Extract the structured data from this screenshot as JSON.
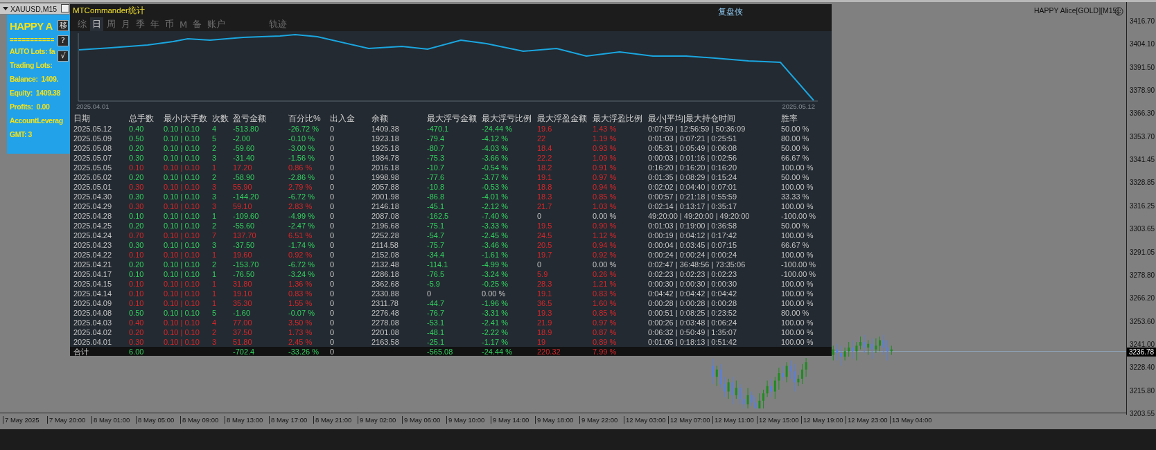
{
  "chart_window": {
    "symbol_tab": "XAUUSD,M15",
    "indicator_label": "HAPPY Alice[GOLD][M15]",
    "price_axis": [
      "3416.70",
      "3404.10",
      "3391.50",
      "3378.90",
      "3366.30",
      "3353.70",
      "3341.45",
      "3328.85",
      "3316.25",
      "3303.65",
      "3291.05",
      "3278.80",
      "3266.20",
      "3253.60",
      "3241.00",
      "3228.40",
      "3215.80",
      "3203.55"
    ],
    "current_price": "3236.78",
    "time_axis": [
      "7 May 2025",
      "7 May 20:00",
      "8 May 01:00",
      "8 May 05:00",
      "8 May 09:00",
      "8 May 13:00",
      "8 May 17:00",
      "8 May 21:00",
      "9 May 02:00",
      "9 May 06:00",
      "9 May 10:00",
      "9 May 14:00",
      "9 May 18:00",
      "9 May 22:00",
      "12 May 03:00",
      "12 May 07:00",
      "12 May 11:00",
      "12 May 15:00",
      "12 May 19:00",
      "12 May 23:00",
      "13 May 04:00"
    ]
  },
  "info_panel": {
    "title": "HAPPY A",
    "divider": "===========",
    "lines": [
      "AUTO Lots: fa",
      "Trading Lots:",
      "Balance:  1409.",
      "Equity:  1409.38",
      "Profits:  0.00",
      "AccountLeverag",
      "GMT: 3"
    ],
    "buttons": [
      "移",
      "?",
      "√"
    ]
  },
  "stats_window": {
    "title": "MTCommander统计",
    "brand": "复盘侠",
    "tabs": [
      {
        "label": "综",
        "selected": false
      },
      {
        "label": "日",
        "selected": true
      },
      {
        "label": "周",
        "selected": false
      },
      {
        "label": "月",
        "selected": false
      },
      {
        "label": "季",
        "selected": false
      },
      {
        "label": "年",
        "selected": false
      },
      {
        "label": "币",
        "selected": false
      },
      {
        "label": "M",
        "selected": false
      },
      {
        "label": "备",
        "selected": false
      },
      {
        "label": "账户",
        "selected": false
      }
    ],
    "trace_tab": "轨迹",
    "equity_chart": {
      "start_label": "2025.04.01",
      "end_label": "2025.05.12"
    },
    "table": {
      "columns": [
        "日期",
        "总手数",
        "最小|大手数",
        "次数",
        "盈亏金额",
        "百分比%",
        "出入金",
        "余额",
        "最大浮亏金额",
        "最大浮亏比例",
        "最大浮盈金额",
        "最大浮盈比例",
        "最小|平均|最大持仓时间",
        "胜率"
      ],
      "rows": [
        {
          "kind": "loss",
          "float_loss_flat": false,
          "float_profit_flat": false,
          "cells": [
            "2025.05.12",
            "0.40",
            "0.10 | 0.10",
            "4",
            "-513.80",
            "-26.72 %",
            "0",
            "1409.38",
            "-470.1",
            "-24.44 %",
            "19.6",
            "1.43 %",
            "0:07:59 | 12:56:59 | 50:36:09",
            "50.00 %"
          ]
        },
        {
          "kind": "loss",
          "float_loss_flat": false,
          "float_profit_flat": false,
          "cells": [
            "2025.05.09",
            "0.50",
            "0.10 | 0.10",
            "5",
            "-2.00",
            "-0.10 %",
            "0",
            "1923.18",
            "-79.4",
            "-4.12 %",
            "22",
            "1.19 %",
            "0:01:03 | 0:07:21 | 0:25:51",
            "80.00 %"
          ]
        },
        {
          "kind": "loss",
          "float_loss_flat": false,
          "float_profit_flat": false,
          "cells": [
            "2025.05.08",
            "0.20",
            "0.10 | 0.10",
            "2",
            "-59.60",
            "-3.00 %",
            "0",
            "1925.18",
            "-80.7",
            "-4.03 %",
            "18.4",
            "0.93 %",
            "0:05:31 | 0:05:49 | 0:06:08",
            "50.00 %"
          ]
        },
        {
          "kind": "loss",
          "float_loss_flat": false,
          "float_profit_flat": false,
          "cells": [
            "2025.05.07",
            "0.30",
            "0.10 | 0.10",
            "3",
            "-31.40",
            "-1.56 %",
            "0",
            "1984.78",
            "-75.3",
            "-3.66 %",
            "22.2",
            "1.09 %",
            "0:00:03 | 0:01:16 | 0:02:56",
            "66.67 %"
          ]
        },
        {
          "kind": "profit",
          "float_loss_flat": false,
          "float_profit_flat": false,
          "cells": [
            "2025.05.05",
            "0.10",
            "0.10 | 0.10",
            "1",
            "17.20",
            "0.86 %",
            "0",
            "2016.18",
            "-10.7",
            "-0.54 %",
            "18.2",
            "0.91 %",
            "0:16:20 | 0:16:20 | 0:16:20",
            "100.00 %"
          ]
        },
        {
          "kind": "loss",
          "float_loss_flat": false,
          "float_profit_flat": false,
          "cells": [
            "2025.05.02",
            "0.20",
            "0.10 | 0.10",
            "2",
            "-58.90",
            "-2.86 %",
            "0",
            "1998.98",
            "-77.6",
            "-3.77 %",
            "19.1",
            "0.97 %",
            "0:01:35 | 0:08:29 | 0:15:24",
            "50.00 %"
          ]
        },
        {
          "kind": "profit",
          "float_loss_flat": false,
          "float_profit_flat": false,
          "cells": [
            "2025.05.01",
            "0.30",
            "0.10 | 0.10",
            "3",
            "55.90",
            "2.79 %",
            "0",
            "2057.88",
            "-10.8",
            "-0.53 %",
            "18.8",
            "0.94 %",
            "0:02:02 | 0:04:40 | 0:07:01",
            "100.00 %"
          ]
        },
        {
          "kind": "loss",
          "float_loss_flat": false,
          "float_profit_flat": false,
          "cells": [
            "2025.04.30",
            "0.30",
            "0.10 | 0.10",
            "3",
            "-144.20",
            "-6.72 %",
            "0",
            "2001.98",
            "-86.8",
            "-4.01 %",
            "18.3",
            "0.85 %",
            "0:00:57 | 0:21:18 | 0:55:59",
            "33.33 %"
          ]
        },
        {
          "kind": "profit",
          "float_loss_flat": false,
          "float_profit_flat": false,
          "cells": [
            "2025.04.29",
            "0.30",
            "0.10 | 0.10",
            "3",
            "59.10",
            "2.83 %",
            "0",
            "2146.18",
            "-45.1",
            "-2.12 %",
            "21.7",
            "1.03 %",
            "0:02:14 | 0:13:17 | 0:35:17",
            "100.00 %"
          ]
        },
        {
          "kind": "loss",
          "float_loss_flat": false,
          "float_profit_flat": true,
          "cells": [
            "2025.04.28",
            "0.10",
            "0.10 | 0.10",
            "1",
            "-109.60",
            "-4.99 %",
            "0",
            "2087.08",
            "-162.5",
            "-7.40 %",
            "0",
            "0.00 %",
            "49:20:00 | 49:20:00 | 49:20:00",
            "-100.00 %"
          ]
        },
        {
          "kind": "loss",
          "float_loss_flat": false,
          "float_profit_flat": false,
          "cells": [
            "2025.04.25",
            "0.20",
            "0.10 | 0.10",
            "2",
            "-55.60",
            "-2.47 %",
            "0",
            "2196.68",
            "-75.1",
            "-3.33 %",
            "19.5",
            "0.90 %",
            "0:01:03 | 0:19:00 | 0:36:58",
            "50.00 %"
          ]
        },
        {
          "kind": "profit",
          "float_loss_flat": false,
          "float_profit_flat": false,
          "cells": [
            "2025.04.24",
            "0.70",
            "0.10 | 0.10",
            "7",
            "137.70",
            "6.51 %",
            "0",
            "2252.28",
            "-54.7",
            "-2.45 %",
            "24.5",
            "1.12 %",
            "0:00:19 | 0:04:12 | 0:17:42",
            "100.00 %"
          ]
        },
        {
          "kind": "loss",
          "float_loss_flat": false,
          "float_profit_flat": false,
          "cells": [
            "2025.04.23",
            "0.30",
            "0.10 | 0.10",
            "3",
            "-37.50",
            "-1.74 %",
            "0",
            "2114.58",
            "-75.7",
            "-3.46 %",
            "20.5",
            "0.94 %",
            "0:00:04 | 0:03:45 | 0:07:15",
            "66.67 %"
          ]
        },
        {
          "kind": "profit",
          "float_loss_flat": false,
          "float_profit_flat": false,
          "cells": [
            "2025.04.22",
            "0.10",
            "0.10 | 0.10",
            "1",
            "19.60",
            "0.92 %",
            "0",
            "2152.08",
            "-34.4",
            "-1.61 %",
            "19.7",
            "0.92 %",
            "0:00:24 | 0:00:24 | 0:00:24",
            "100.00 %"
          ]
        },
        {
          "kind": "loss",
          "float_loss_flat": false,
          "float_profit_flat": true,
          "cells": [
            "2025.04.21",
            "0.20",
            "0.10 | 0.10",
            "2",
            "-153.70",
            "-6.72 %",
            "0",
            "2132.48",
            "-114.1",
            "-4.99 %",
            "0",
            "0.00 %",
            "0:02:47 | 36:48:56 | 73:35:06",
            "-100.00 %"
          ]
        },
        {
          "kind": "loss",
          "float_loss_flat": false,
          "float_profit_flat": false,
          "cells": [
            "2025.04.17",
            "0.10",
            "0.10 | 0.10",
            "1",
            "-76.50",
            "-3.24 %",
            "0",
            "2286.18",
            "-76.5",
            "-3.24 %",
            "5.9",
            "0.26 %",
            "0:02:23 | 0:02:23 | 0:02:23",
            "-100.00 %"
          ]
        },
        {
          "kind": "profit",
          "float_loss_flat": false,
          "float_profit_flat": false,
          "cells": [
            "2025.04.15",
            "0.10",
            "0.10 | 0.10",
            "1",
            "31.80",
            "1.36 %",
            "0",
            "2362.68",
            "-5.9",
            "-0.25 %",
            "28.3",
            "1.21 %",
            "0:00:30 | 0:00:30 | 0:00:30",
            "100.00 %"
          ]
        },
        {
          "kind": "profit",
          "float_loss_flat": true,
          "float_profit_flat": false,
          "cells": [
            "2025.04.14",
            "0.10",
            "0.10 | 0.10",
            "1",
            "19.10",
            "0.83 %",
            "0",
            "2330.88",
            "0",
            "0.00 %",
            "19.1",
            "0.83 %",
            "0:04:42 | 0:04:42 | 0:04:42",
            "100.00 %"
          ]
        },
        {
          "kind": "profit",
          "float_loss_flat": false,
          "float_profit_flat": false,
          "cells": [
            "2025.04.09",
            "0.10",
            "0.10 | 0.10",
            "1",
            "35.30",
            "1.55 %",
            "0",
            "2311.78",
            "-44.7",
            "-1.96 %",
            "36.5",
            "1.60 %",
            "0:00:28 | 0:00:28 | 0:00:28",
            "100.00 %"
          ]
        },
        {
          "kind": "loss",
          "float_loss_flat": false,
          "float_profit_flat": false,
          "cells": [
            "2025.04.08",
            "0.50",
            "0.10 | 0.10",
            "5",
            "-1.60",
            "-0.07 %",
            "0",
            "2276.48",
            "-76.7",
            "-3.31 %",
            "19.3",
            "0.85 %",
            "0:00:51 | 0:08:25 | 0:23:52",
            "80.00 %"
          ]
        },
        {
          "kind": "profit",
          "float_loss_flat": false,
          "float_profit_flat": false,
          "cells": [
            "2025.04.03",
            "0.40",
            "0.10 | 0.10",
            "4",
            "77.00",
            "3.50 %",
            "0",
            "2278.08",
            "-53.1",
            "-2.41 %",
            "21.9",
            "0.97 %",
            "0:00:26 | 0:03:48 | 0:06:24",
            "100.00 %"
          ]
        },
        {
          "kind": "profit",
          "float_loss_flat": false,
          "float_profit_flat": false,
          "cells": [
            "2025.04.02",
            "0.20",
            "0.10 | 0.10",
            "2",
            "37.50",
            "1.73 %",
            "0",
            "2201.08",
            "-48.1",
            "-2.22 %",
            "18.9",
            "0.87 %",
            "0:06:32 | 0:50:49 | 1:35:07",
            "100.00 %"
          ]
        },
        {
          "kind": "profit",
          "float_loss_flat": false,
          "float_profit_flat": false,
          "cells": [
            "2025.04.01",
            "0.30",
            "0.10 | 0.10",
            "3",
            "51.80",
            "2.45 %",
            "0",
            "2163.58",
            "-25.1",
            "-1.17 %",
            "19",
            "0.89 %",
            "0:01:05 | 0:18:13 | 0:51:42",
            "100.00 %"
          ]
        }
      ],
      "total": {
        "kind": "loss",
        "label": "合计",
        "lots": "6.00",
        "pnl": "-702.4",
        "percent": "-33.26 %",
        "cash_flow": "0",
        "max_float_loss": "-565.08",
        "max_float_loss_pct": "-24.44 %",
        "max_float_profit": "220.32",
        "max_float_profit_pct": "7.99 %"
      }
    }
  }
}
